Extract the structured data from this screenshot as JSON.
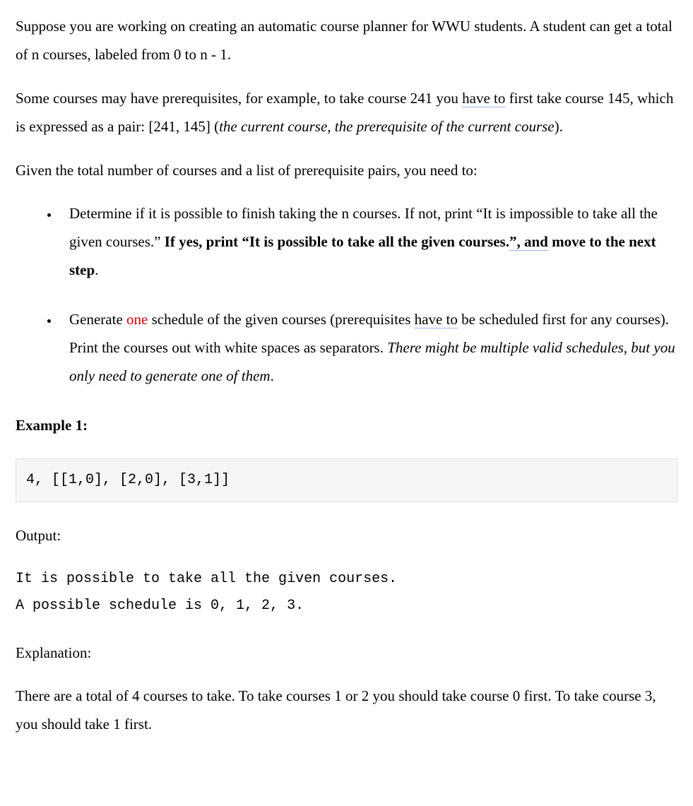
{
  "intro": {
    "p1a": "Suppose you are working on creating an automatic course planner for WWU students. A student can get a total of n courses, labeled from 0 to n - 1.",
    "p2_pre": "Some courses may have prerequisites, for example, to take course 241 you ",
    "p2_haveto": "have to",
    "p2_mid": " first take course 145, which is expressed as a pair: [241, 145] (",
    "p2_italic": "the current course, the prerequisite of the current course",
    "p2_post": ").",
    "p3": "Given the total number of courses and a list of prerequisite pairs, you need to:"
  },
  "bullets": {
    "b1_pre": "Determine if it is possible to finish taking the n courses. If not, print “It is impossible to take all the given courses.” ",
    "b1_bold_pre": "If yes, print “It is possible to take all the given courses.",
    "b1_bold_dotted": "”, and",
    "b1_bold_post": " move to the next step",
    "b1_period": ".",
    "b2_pre": "Generate ",
    "b2_one": "one",
    "b2_mid": " schedule of the given courses (prerequisites ",
    "b2_haveto": "have to",
    "b2_post": " be scheduled first for any courses). Print the courses out with white spaces as separators. ",
    "b2_italic": "There might be multiple valid schedules, but you only need to generate one of them",
    "b2_period": "."
  },
  "example": {
    "heading": "Example 1:",
    "input": "4, [[1,0], [2,0], [3,1]]",
    "output_label": "Output:",
    "output_text": "It is possible to take all the given courses.\nA possible schedule is 0, 1, 2, 3.",
    "explanation_label": "Explanation:",
    "explanation_text": "There are a total of 4 courses to take. To take courses 1 or 2 you should take course 0 first. To take course 3, you should take 1 first."
  }
}
